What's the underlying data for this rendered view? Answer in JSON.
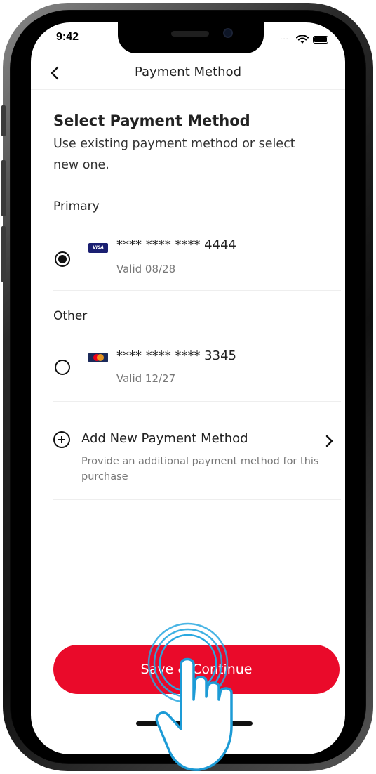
{
  "status_bar": {
    "time": "9:42"
  },
  "nav": {
    "title": "Payment Method"
  },
  "header": {
    "title": "Select Payment Method",
    "subtitle": "Use existing payment method or select new one."
  },
  "primary": {
    "label": "Primary",
    "card": {
      "brand": "VISA",
      "number": "**** **** **** 4444",
      "valid": "Valid 08/28",
      "selected": true
    }
  },
  "other": {
    "label": "Other",
    "card": {
      "brand": "mastercard",
      "number": "**** **** **** 3345",
      "valid": "Valid 12/27",
      "selected": false
    }
  },
  "add_method": {
    "title": "Add New Payment Method",
    "description": "Provide an additional payment method for this purchase"
  },
  "actions": {
    "save_label": "Save & Continue"
  },
  "colors": {
    "primary_button": "#ea0a2a",
    "tap_ring": "#29a8e0"
  },
  "icons": {
    "back": "chevron-left-icon",
    "wifi": "wifi-icon",
    "battery": "battery-icon",
    "add": "plus-circle-icon",
    "chevron": "chevron-right-icon",
    "pointer": "hand-pointer-icon"
  }
}
